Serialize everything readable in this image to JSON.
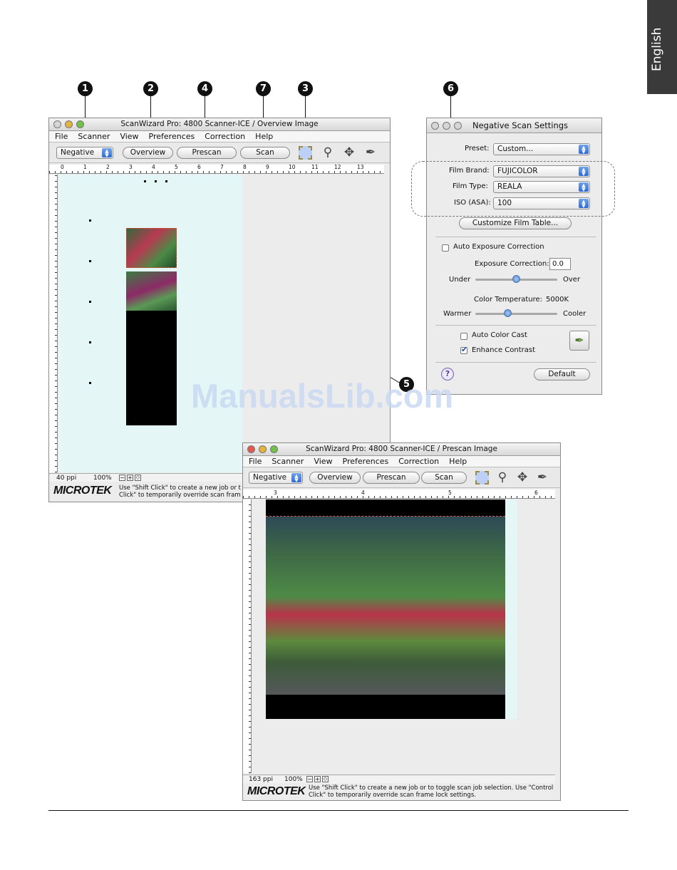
{
  "side_tab": {
    "label": "English"
  },
  "callouts": [
    "1",
    "2",
    "4",
    "7",
    "3",
    "6",
    "5"
  ],
  "overview_window": {
    "title": "ScanWizard Pro: 4800 Scanner-ICE / Overview Image",
    "menu": [
      "File",
      "Scanner",
      "View",
      "Preferences",
      "Correction",
      "Help"
    ],
    "mode_select": "Negative",
    "buttons": {
      "overview": "Overview",
      "prescan": "Prescan",
      "scan": "Scan"
    },
    "ruler_numbers": [
      "0",
      "1",
      "2",
      "3",
      "4",
      "5",
      "6",
      "7",
      "8",
      "9",
      "10",
      "11",
      "12",
      "13"
    ],
    "status": {
      "resolution": "40 ppi",
      "zoom": "100%"
    },
    "brand": "MICROTEK",
    "hint_line1": "Use \"Shift Click\" to create a new job or t",
    "hint_line2": "Click\" to temporarily override scan fram"
  },
  "prescan_window": {
    "title": "ScanWizard Pro: 4800 Scanner-ICE / Prescan Image",
    "menu": [
      "File",
      "Scanner",
      "View",
      "Preferences",
      "Correction",
      "Help"
    ],
    "mode_select": "Negative",
    "buttons": {
      "overview": "Overview",
      "prescan": "Prescan",
      "scan": "Scan"
    },
    "ruler_numbers": [
      "3",
      "4",
      "5",
      "6"
    ],
    "status": {
      "resolution": "163 ppi",
      "zoom": "100%"
    },
    "brand": "MICROTEK",
    "hint_line1": "Use \"Shift Click\" to create a new job or to toggle scan job selection. Use \"Control",
    "hint_line2": "Click\" to temporarily override scan frame lock settings."
  },
  "settings_dialog": {
    "title": "Negative Scan Settings",
    "preset_label": "Preset:",
    "preset_value": "Custom...",
    "film_brand_label": "Film Brand:",
    "film_brand_value": "FUJICOLOR",
    "film_type_label": "Film Type:",
    "film_type_value": "REALA",
    "iso_label": "ISO (ASA):",
    "iso_value": "100",
    "customize_button": "Customize Film Table...",
    "auto_exposure_label": "Auto Exposure Correction",
    "auto_exposure_checked": false,
    "exposure_label": "Exposure Correction:",
    "exposure_value": "0.0",
    "under_label": "Under",
    "over_label": "Over",
    "exposure_slider_level": 0.5,
    "color_temp_label": "Color Temperature:",
    "color_temp_value": "5000K",
    "warmer_label": "Warmer",
    "cooler_label": "Cooler",
    "color_temp_slider_level": 0.4,
    "auto_color_cast_label": "Auto Color Cast",
    "auto_color_cast_checked": false,
    "enhance_contrast_label": "Enhance Contrast",
    "enhance_contrast_checked": true,
    "help_button": "?",
    "default_button": "Default"
  },
  "watermark": "ManualsLib.com",
  "colors": {
    "canvas": "#e4f6f6",
    "accent_blue": "#2f6ad6",
    "watermark": "#c9d9f2"
  }
}
